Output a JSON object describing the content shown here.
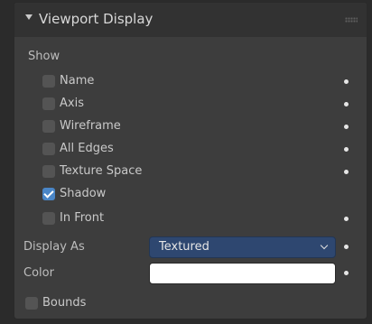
{
  "panel": {
    "title": "Viewport Display"
  },
  "show": {
    "label": "Show",
    "items": [
      {
        "label": "Name",
        "checked": false,
        "dot": true
      },
      {
        "label": "Axis",
        "checked": false,
        "dot": true
      },
      {
        "label": "Wireframe",
        "checked": false,
        "dot": true
      },
      {
        "label": "All Edges",
        "checked": false,
        "dot": true
      },
      {
        "label": "Texture Space",
        "checked": false,
        "dot": true
      },
      {
        "label": "Shadow",
        "checked": true,
        "dot": false
      },
      {
        "label": "In Front",
        "checked": false,
        "dot": true
      }
    ]
  },
  "display_as": {
    "label": "Display As",
    "value": "Textured"
  },
  "color": {
    "label": "Color",
    "value": "#ffffff"
  },
  "bounds": {
    "label": "Bounds",
    "checked": false
  },
  "colors": {
    "panel_bg": "#3d3d3d",
    "header_bg": "#323232",
    "checkbox_checked": "#4a86c7",
    "select_bg": "#2e4770"
  }
}
